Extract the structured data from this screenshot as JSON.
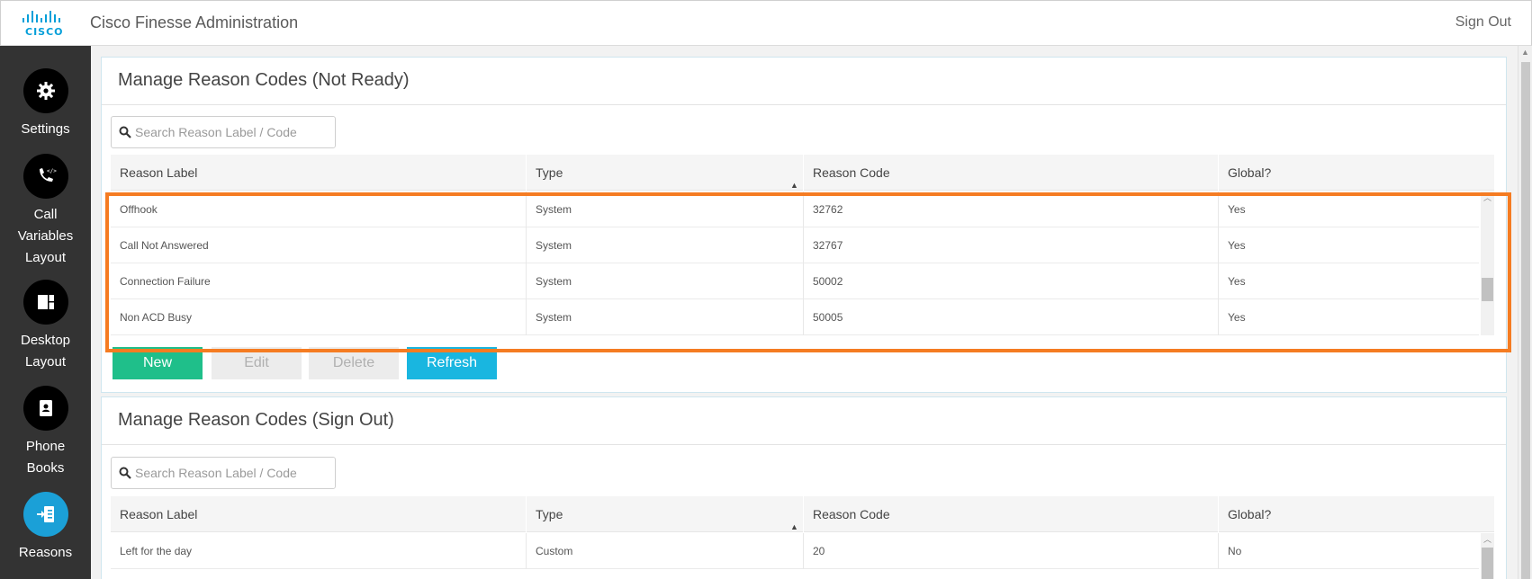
{
  "header": {
    "logo_text": "CISCO",
    "app_title": "Cisco Finesse Administration",
    "signout_label": "Sign Out"
  },
  "sidebar": {
    "items": [
      {
        "lines": [
          "Settings"
        ],
        "icon": "gear-icon",
        "active": false
      },
      {
        "lines": [
          "Call",
          "Variables",
          "Layout"
        ],
        "icon": "phone-code-icon",
        "active": false
      },
      {
        "lines": [
          "Desktop",
          "Layout"
        ],
        "icon": "dashboard-icon",
        "active": false
      },
      {
        "lines": [
          "Phone",
          "Books"
        ],
        "icon": "contact-book-icon",
        "active": false
      },
      {
        "lines": [
          "Reasons"
        ],
        "icon": "reasons-icon",
        "active": true
      }
    ]
  },
  "not_ready": {
    "title": "Manage Reason Codes (Not Ready)",
    "search_placeholder": "Search Reason Label / Code",
    "columns": [
      "Reason Label",
      "Type",
      "Reason Code",
      "Global?"
    ],
    "rows": [
      [
        "Offhook",
        "System",
        "32762",
        "Yes"
      ],
      [
        "Call Not Answered",
        "System",
        "32767",
        "Yes"
      ],
      [
        "Connection Failure",
        "System",
        "50002",
        "Yes"
      ],
      [
        "Non ACD Busy",
        "System",
        "50005",
        "Yes"
      ]
    ],
    "buttons": {
      "new": "New",
      "edit": "Edit",
      "delete": "Delete",
      "refresh": "Refresh"
    }
  },
  "sign_out": {
    "title": "Manage Reason Codes (Sign Out)",
    "search_placeholder": "Search Reason Label / Code",
    "columns": [
      "Reason Label",
      "Type",
      "Reason Code",
      "Global?"
    ],
    "rows": [
      [
        "Left for the day",
        "Custom",
        "20",
        "No"
      ]
    ]
  },
  "colors": {
    "sidebar_bg": "#333333",
    "active_nav": "#1ba0d7",
    "new_button": "#1fbf8a",
    "refresh_button": "#19b6e0",
    "highlight_border": "#f57c22"
  }
}
